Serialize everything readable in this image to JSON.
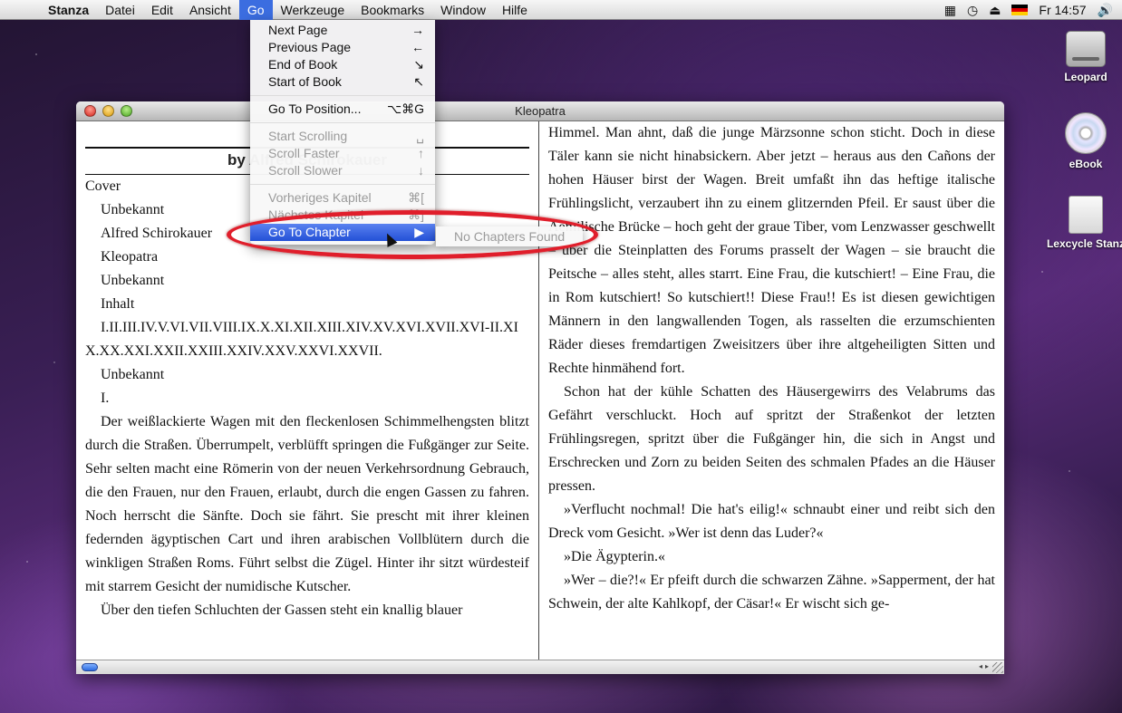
{
  "menubar": {
    "app_name": "Stanza",
    "menus": [
      "Datei",
      "Edit",
      "Ansicht",
      "Go",
      "Werkzeuge",
      "Bookmarks",
      "Window",
      "Hilfe"
    ],
    "active_menu": "Go",
    "clock": "Fr 14:57"
  },
  "desktop_icons": [
    "Leopard",
    "eBook",
    "Lexcycle Stanz"
  ],
  "window": {
    "title": "Kleopatra"
  },
  "left_page": {
    "byline": "by Alfred Schirokauer",
    "toc": [
      "Cover",
      "Unbekannt",
      "Alfred Schirokauer",
      "Kleopatra",
      "Unbekannt",
      "Inhalt"
    ],
    "chapters_line": "I.II.III.IV.V.VI.VII.VIII.IX.X.XI.XII.XIII.XIV.XV.XVI.XVII.XVI-II.XIX.XX.XXI.XXII.XXIII.XXIV.XXV.XXVI.XXVII.",
    "after": [
      "Unbekannt",
      "I."
    ],
    "p1": "Der weißlackierte Wagen mit den fleckenlosen Schimmelhengsten blitzt durch die Straßen. Überrumpelt, verblüfft springen die Fußgänger zur Seite. Sehr selten macht eine Römerin von der neuen Verkehrsordnung Gebrauch, die den Frauen, nur den Frauen, erlaubt, durch die engen Gassen zu fahren. Noch herrscht die Sänfte. Doch sie fährt. Sie prescht mit ihrer kleinen federnden ägyptischen Cart und ihren arabischen Vollblütern durch die winkligen Straßen Roms. Führt selbst die Zügel. Hinter ihr sitzt würdesteif mit starrem Gesicht der numidische Kutscher.",
    "p2": "Über den tiefen Schluchten der Gassen steht ein knallig blauer"
  },
  "right_page": {
    "p1": "Himmel. Man ahnt, daß die junge Märzsonne schon sticht. Doch in diese Täler kann sie nicht hinabsickern. Aber jetzt – heraus aus den Cañons der hohen Häuser birst der Wagen. Breit umfaßt ihn das heftige italische Frühlingslicht, verzaubert ihn zu einem glitzernden Pfeil. Er saust über die Aemilische Brücke – hoch geht der graue Tiber, vom Lenzwasser geschwellt – über die Steinplatten des Forums prasselt der Wagen – sie braucht die Peitsche – alles steht, alles starrt. Eine Frau, die kutschiert! – Eine Frau, die in Rom kutschiert! So kutschiert!! Diese Frau!! Es ist diesen gewichtigen Männern in den langwallenden Togen, als rasselten die erzumschienten Räder dieses fremdartigen Zweisitzers über ihre altgeheiligten Sitten und Rechte hinmähend fort.",
    "p2": "Schon hat der kühle Schatten des Häusergewirrs des Velabrums das Gefährt verschluckt. Hoch auf spritzt der Straßenkot der letzten Frühlingsregen, spritzt über die Fußgänger hin, die sich in Angst und Erschrecken und Zorn zu beiden Seiten des schmalen Pfades an die Häuser pressen.",
    "p3": "»Verflucht nochmal! Die hat's eilig!« schnaubt einer und reibt sich den Dreck vom Gesicht. »Wer ist denn das Luder?«",
    "p4": "»Die Ägypterin.«",
    "p5": "»Wer – die?!« Er pfeift durch die schwarzen Zähne. »Sapperment, der hat Schwein, der alte Kahlkopf, der Cäsar!« Er wischt sich ge-"
  },
  "go_menu": {
    "items": [
      {
        "label": "Next Page",
        "shortcut": "→"
      },
      {
        "label": "Previous Page",
        "shortcut": "←"
      },
      {
        "label": "End of Book",
        "shortcut": "↘"
      },
      {
        "label": "Start of Book",
        "shortcut": "↖"
      },
      {
        "label": "Go To Position...",
        "shortcut": "⌥⌘G"
      },
      {
        "label": "Start Scrolling",
        "shortcut": "␣"
      },
      {
        "label": "Scroll Faster",
        "shortcut": "↑"
      },
      {
        "label": "Scroll Slower",
        "shortcut": "↓"
      },
      {
        "label": "Vorheriges Kapitel",
        "shortcut": "⌘["
      },
      {
        "label": "Nächstes Kapitel",
        "shortcut": "⌘]"
      },
      {
        "label": "Go To Chapter",
        "shortcut": "▶"
      }
    ],
    "submenu_item": "No Chapters Found"
  }
}
